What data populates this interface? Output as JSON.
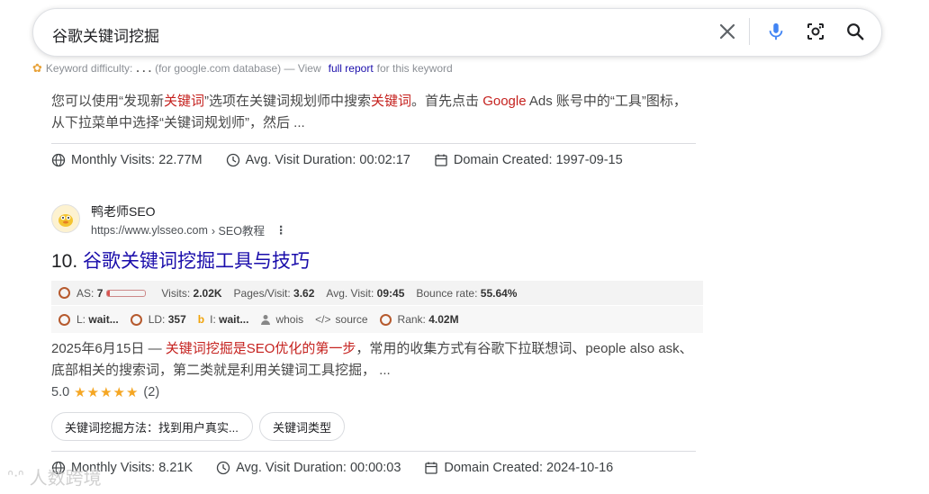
{
  "search": {
    "query": "谷歌关键词挖掘",
    "icons": [
      "close-icon",
      "microphone-icon",
      "lens-icon",
      "search-icon"
    ]
  },
  "kd": {
    "label": "Keyword difficulty:",
    "dots": ". . .",
    "db": "(for google.com database) — View",
    "link": "full report",
    "tail": "for this keyword"
  },
  "prev_result": {
    "snippet": [
      {
        "t": "您可以使用“发现新"
      },
      {
        "t": "关键词",
        "hl": true
      },
      {
        "t": "”选项在关键词规划师中搜索"
      },
      {
        "t": "关键词",
        "hl": true
      },
      {
        "t": "。首先点击 "
      },
      {
        "t": "Google",
        "hl": true
      },
      {
        "t": " Ads 账号中的“工具”图标，从下拉菜单中选择“关键词规划师”，然后 ..."
      }
    ],
    "metrics": {
      "visits": "Monthly Visits: 22.77M",
      "duration": "Avg. Visit Duration: 00:02:17",
      "created": "Domain Created: 1997-09-15"
    }
  },
  "result": {
    "site_name": "鸭老师SEO",
    "url": "https://www.ylsseo.com",
    "breadcrumb": "› SEO教程",
    "number": "10.",
    "title": "谷歌关键词挖掘工具与技巧",
    "seo_row1": {
      "as_label": "AS:",
      "as_value": "7",
      "as_fraction": 0.07,
      "visits_label": "Visits:",
      "visits": "2.02K",
      "pages_label": "Pages/Visit:",
      "pages": "3.62",
      "avg_label": "Avg. Visit:",
      "avg": "09:45",
      "bounce_label": "Bounce rate:",
      "bounce": "55.64%"
    },
    "seo_row2": {
      "l_label": "L:",
      "l_value": "wait...",
      "ld_label": "LD:",
      "ld_value": "357",
      "i_label": "I:",
      "i_value": "wait...",
      "whois": "whois",
      "source": "source",
      "rank_label": "Rank:",
      "rank": "4.02M"
    },
    "snippet": [
      {
        "t": "2025年6月15日 — "
      },
      {
        "t": "关键词挖掘是SEO优化的第一步",
        "hl": true
      },
      {
        "t": "，常用的收集方式有谷歌下拉联想词、people also ask、底部相关的搜索词，第二类就是利用关键词工具挖掘， ..."
      }
    ],
    "rating": "5.0",
    "stars": "★★★★★",
    "reviews": "(2)",
    "chips": [
      "关键词挖掘方法：找到用户真实...",
      "关键词类型"
    ],
    "metrics": {
      "visits": "Monthly Visits: 8.21K",
      "duration": "Avg. Visit Duration: 00:00:03",
      "created": "Domain Created: 2024-10-16"
    }
  },
  "watermark": "人数跨境",
  "colors": {
    "link": "#1a0dab",
    "highlight": "#c5221f",
    "star": "#f5a623",
    "ring": "#b65a2e"
  }
}
